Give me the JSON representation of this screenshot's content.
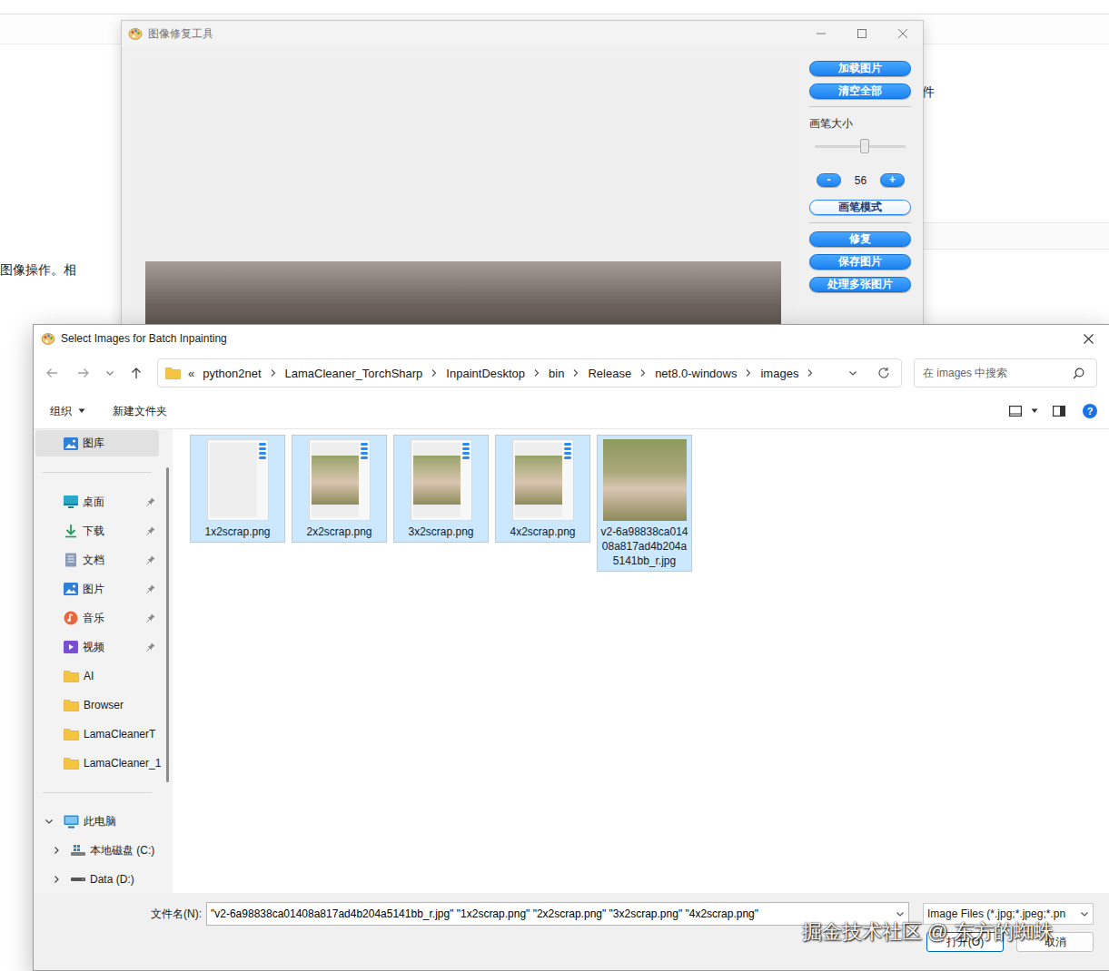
{
  "background": {
    "left_text": "图像操作。相",
    "right_text": "件"
  },
  "app": {
    "title": "图像修复工具",
    "top_buttons": [
      "加载图片",
      "清空全部"
    ],
    "brush": {
      "label": "画笔大小",
      "level": 0.55,
      "value": "56",
      "minus": "-",
      "plus": "+"
    },
    "mode_button": {
      "label": "画笔模式",
      "toggled": true
    },
    "action_buttons": [
      "修复",
      "保存图片",
      "处理多张图片"
    ]
  },
  "dialog": {
    "title": "Select Images for Batch Inpainting",
    "breadcrumb": {
      "prefix": "«",
      "parts": [
        "python2net",
        "LamaCleaner_TorchSharp",
        "InpaintDesktop",
        "bin",
        "Release",
        "net8.0-windows",
        "images"
      ]
    },
    "search": {
      "placeholder": "在 images 中搜索"
    },
    "toolbar": {
      "organize": "组织",
      "new_folder": "新建文件夹",
      "help": "?"
    },
    "sidebar": [
      {
        "label": "图库",
        "kind": "gallery",
        "selected": true,
        "pinned": false
      },
      {
        "label": "桌面",
        "kind": "desktop",
        "selected": false,
        "pinned": true
      },
      {
        "label": "下载",
        "kind": "download",
        "selected": false,
        "pinned": true
      },
      {
        "label": "文档",
        "kind": "documents",
        "selected": false,
        "pinned": true
      },
      {
        "label": "图片",
        "kind": "pictures",
        "selected": false,
        "pinned": true
      },
      {
        "label": "音乐",
        "kind": "music",
        "selected": false,
        "pinned": true
      },
      {
        "label": "视频",
        "kind": "videos",
        "selected": false,
        "pinned": true
      },
      {
        "label": "AI",
        "kind": "folder",
        "selected": false,
        "pinned": false
      },
      {
        "label": "Browser",
        "kind": "folder",
        "selected": false,
        "pinned": false
      },
      {
        "label": "LamaCleanerT",
        "kind": "folder",
        "selected": false,
        "pinned": false
      },
      {
        "label": "LamaCleaner_1",
        "kind": "folder",
        "selected": false,
        "pinned": false
      }
    ],
    "tree": [
      {
        "label": "此电脑",
        "kind": "pc",
        "child": false,
        "expanded": true
      },
      {
        "label": "本地磁盘 (C:)",
        "kind": "system-drive",
        "child": true,
        "expanded": false
      },
      {
        "label": "Data (D:)",
        "kind": "drive",
        "child": true,
        "expanded": false
      }
    ],
    "files": [
      {
        "name": "1x2scrap.png",
        "kind": "blank-app",
        "selected": true
      },
      {
        "name": "2x2scrap.png",
        "kind": "photo-app",
        "selected": true
      },
      {
        "name": "3x2scrap.png",
        "kind": "photo-app",
        "selected": true
      },
      {
        "name": "4x2scrap.png",
        "kind": "photo-app",
        "selected": true
      },
      {
        "name": "v2-6a98838ca01408a817ad4b204a5141bb_r.jpg",
        "kind": "photo",
        "selected": true
      }
    ],
    "filename": {
      "label": "文件名(N):",
      "value": "\"v2-6a98838ca01408a817ad4b204a5141bb_r.jpg\" \"1x2scrap.png\" \"2x2scrap.png\" \"3x2scrap.png\" \"4x2scrap.png\""
    },
    "filter": "Image Files (*.jpg;*.jpeg;*.pn",
    "buttons": [
      "打开(O)",
      "取消"
    ]
  },
  "watermark": "掘金技术社区 @ 东方的蜘蛛"
}
